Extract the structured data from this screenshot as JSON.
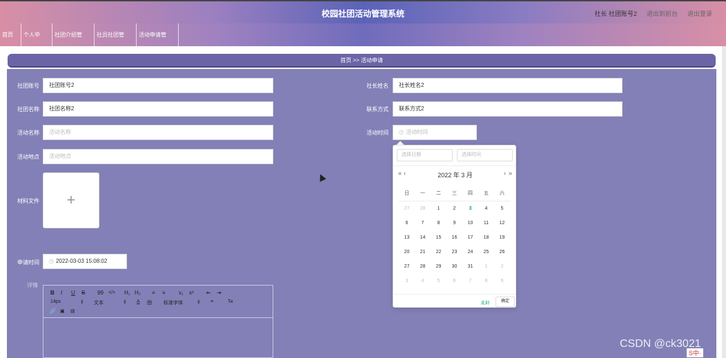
{
  "header": {
    "title": "校园社团活动管理系统",
    "user": "社长 社团账号2",
    "back_link": "退出到前台",
    "logout": "退出登录"
  },
  "nav": [
    {
      "label": "首页",
      "chev": ""
    },
    {
      "label": "个人中心",
      "chev": "﹀"
    },
    {
      "label": "社团介绍管理",
      "chev": "﹀"
    },
    {
      "label": "社员社团管理",
      "chev": "﹀"
    },
    {
      "label": "活动申请管理",
      "chev": "﹀"
    }
  ],
  "breadcrumb": "首页 >> 活动申请",
  "form": {
    "club_account_label": "社团账号",
    "club_account_value": "社团账号2",
    "president_name_label": "社长姓名",
    "president_name_value": "社长姓名2",
    "club_name_label": "社团名称",
    "club_name_value": "社团名称2",
    "contact_label": "联系方式",
    "contact_value": "联系方式2",
    "activity_name_label": "活动名称",
    "activity_name_placeholder": "活动名称",
    "activity_time_label": "活动时间",
    "activity_time_placeholder": "活动时间",
    "activity_place_label": "活动地点",
    "activity_place_placeholder": "活动地点",
    "material_label": "材料文件",
    "upload_plus": "+",
    "apply_time_label": "申请时间",
    "apply_time_value": "2022-03-03 15:08:02",
    "detail_label": "详情"
  },
  "editor_tools": {
    "bold": "B",
    "italic": "I",
    "underline": "U",
    "strike": "S",
    "quote": "99",
    "code": "</>",
    "h1": "H₁",
    "h2": "H₂",
    "ol": "≡",
    "ul": "≡",
    "sub": "x₁",
    "sup": "x²",
    "outdent": "⇤",
    "indent": "⇥",
    "size": "14px",
    "paragraph": "文本",
    "color": "A",
    "bg": "囫",
    "font": "标准字体",
    "align": "≡",
    "clear": "T̶x",
    "link": "🔗",
    "image": "▣",
    "video": "▤"
  },
  "picker": {
    "date_placeholder": "选择日期",
    "time_placeholder": "选择时间",
    "prev_year": "«",
    "prev_month": "‹",
    "next_month": "›",
    "next_year": "»",
    "header": "2022 年 3 月",
    "weekdays": [
      "日",
      "一",
      "二",
      "三",
      "四",
      "五",
      "六"
    ],
    "days": [
      [
        "27",
        "28",
        "1",
        "2",
        "3",
        "4",
        "5"
      ],
      [
        "6",
        "7",
        "8",
        "9",
        "10",
        "11",
        "12"
      ],
      [
        "13",
        "14",
        "15",
        "16",
        "17",
        "18",
        "19"
      ],
      [
        "20",
        "21",
        "22",
        "23",
        "24",
        "25",
        "26"
      ],
      [
        "27",
        "28",
        "29",
        "30",
        "31",
        "1",
        "2"
      ],
      [
        "3",
        "4",
        "5",
        "6",
        "7",
        "8",
        "9"
      ]
    ],
    "now": "此刻",
    "ok": "确定"
  },
  "watermark": "CSDN @ck3021",
  "tray": "S中·"
}
